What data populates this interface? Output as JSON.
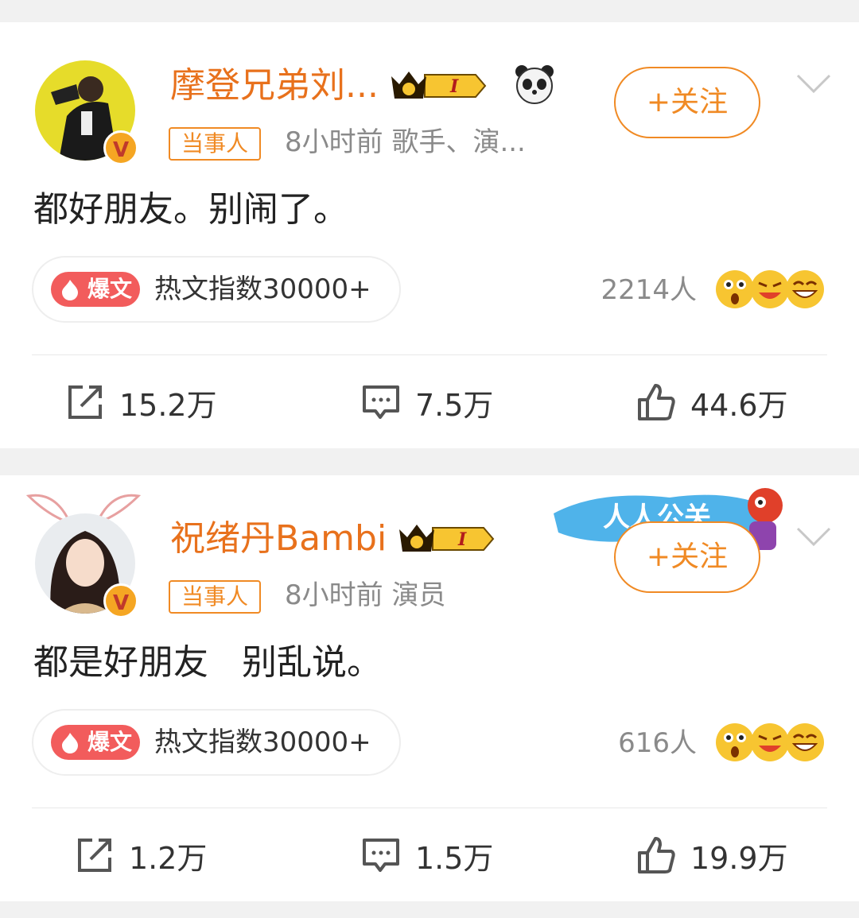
{
  "posts": [
    {
      "name": "摩登兄弟刘...",
      "tag": "当事人",
      "meta": "8小时前   歌手、演...",
      "follow": "+关注",
      "content": "都好朋友。别闹了。",
      "hot_badge": "爆文",
      "hot_label": "热文指数30000+",
      "count": "2214人",
      "actions": {
        "repost": "15.2万",
        "comment": "7.5万",
        "like": "44.6万"
      }
    },
    {
      "name": "祝绪丹Bambi",
      "tag": "当事人",
      "meta": "8小时前   演员",
      "follow": "+关注",
      "content": "都是好朋友   别乱说。",
      "hot_badge": "爆文",
      "hot_label": "热文指数30000+",
      "count": "616人",
      "actions": {
        "repost": "1.2万",
        "comment": "1.5万",
        "like": "19.9万"
      },
      "sticker_text": "人人公关"
    }
  ],
  "icons": {
    "verified": "v-badge-icon",
    "crown": "crown-level-icon",
    "panda": "panda-icon",
    "repost": "share-icon",
    "comment": "comment-icon",
    "like": "thumbs-up-icon",
    "more": "chevron-down-icon"
  },
  "colors": {
    "accent": "#f08a24",
    "name": "#e8711c",
    "hot": "#f25c5c",
    "muted": "#8a8a8a"
  }
}
